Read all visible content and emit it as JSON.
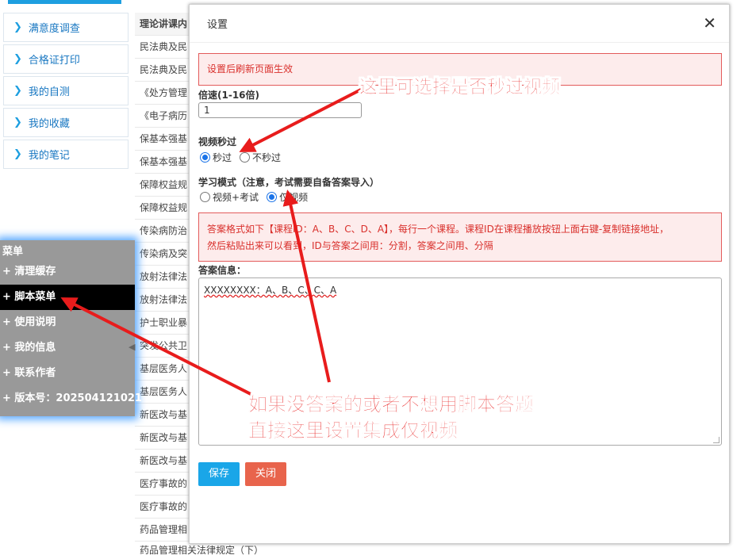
{
  "sidebar": {
    "items": [
      {
        "label": "满意度调查"
      },
      {
        "label": "合格证打印"
      },
      {
        "label": "我的自测"
      },
      {
        "label": "我的收藏"
      },
      {
        "label": "我的笔记"
      }
    ]
  },
  "table": {
    "header": "理论讲课内",
    "rows": [
      "民法典及民",
      "民法典及民",
      "《处方管理",
      "《电子病历",
      "保基本强基",
      "保基本强基",
      "保障权益规",
      "保障权益规",
      "传染病防治",
      "传染病及突",
      "放射法律法",
      "放射法律法",
      "护士职业暴",
      "突发公共卫",
      "基层医务人",
      "基层医务人",
      "新医改与基",
      "新医改与基",
      "新医改与基",
      "医疗事故的",
      "医疗事故的",
      "药品管理相"
    ],
    "last_row": "药品管理相关法律规定（下）"
  },
  "menu": {
    "title": "菜单",
    "items": [
      "+ 清理缓存",
      "+ 脚本菜单",
      "+ 使用说明",
      "+ 我的信息",
      "+ 联系作者",
      "+ 版本号：202504121021"
    ]
  },
  "dialog": {
    "title": "设置",
    "close_symbol": "✕",
    "notice": "设置后刷新页面生效",
    "speed_label": "倍速(1-16倍)",
    "speed_value": "1",
    "skip_label": "视频秒过",
    "skip_options": [
      {
        "label": "秒过",
        "checked": true
      },
      {
        "label": "不秒过",
        "checked": false
      }
    ],
    "mode_label": "学习模式（注意，考试需要自备答案导入）",
    "mode_options": [
      {
        "label": "视频+考试",
        "checked": false
      },
      {
        "label": "仅视频",
        "checked": true
      }
    ],
    "format_note_line1": "答案格式如下【课程ID：A、B、C、D、A】，每行一个课程。课程ID在课程播放按钮上面右键-复制链接地址，",
    "format_note_line2": "然后粘贴出来可以看到，ID与答案之间用：分割，答案之间用、分隔",
    "answer_label": "答案信息：",
    "answer_value": "XXXXXXXX：A、B、C、C、A",
    "save_label": "保存",
    "close_label": "关闭"
  },
  "annotations": {
    "top": "这里可选择是否秒过视频",
    "bottom_line1": "如果没答案的或者不想用脚本答题",
    "bottom_line2": "直接这里设置集成仅视频",
    "color": "#e81c1c"
  },
  "colors": {
    "accent": "#1aa6e8",
    "danger": "#e8644c",
    "menu_glow": "#5aa9ff"
  }
}
